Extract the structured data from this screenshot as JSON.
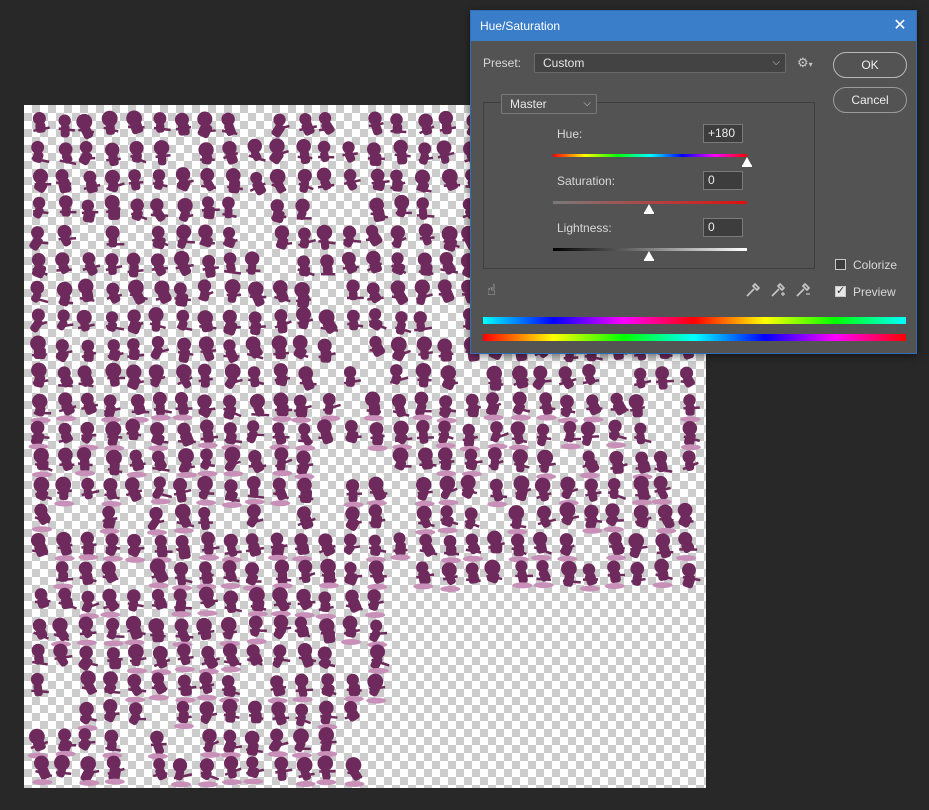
{
  "dialog": {
    "title": "Hue/Saturation",
    "close_glyph": "✕",
    "preset": {
      "label": "Preset:",
      "value": "Custom"
    },
    "channel": {
      "value": "Master"
    },
    "sliders": [
      {
        "label": "Hue:",
        "value": "+180"
      },
      {
        "label": "Saturation:",
        "value": "0"
      },
      {
        "label": "Lightness:",
        "value": "0"
      }
    ],
    "buttons": {
      "ok": "OK",
      "cancel": "Cancel"
    },
    "colorize": {
      "label": "Colorize",
      "checked": false
    },
    "preview": {
      "label": "Preview",
      "checked": true
    }
  },
  "icons": {
    "settings": "gear-icon",
    "hand": "hand-adjust-icon",
    "eyedropper": "eyedropper-icon",
    "eyedropper_plus": "eyedropper-plus-icon",
    "eyedropper_minus": "eyedropper-minus-icon"
  },
  "colors": {
    "app_background": "#282828",
    "dialog_background": "#535353",
    "titlebar": "#3a7ec9",
    "sprite_dark": "#6e2a5c",
    "sprite_light": "#c890b8"
  }
}
